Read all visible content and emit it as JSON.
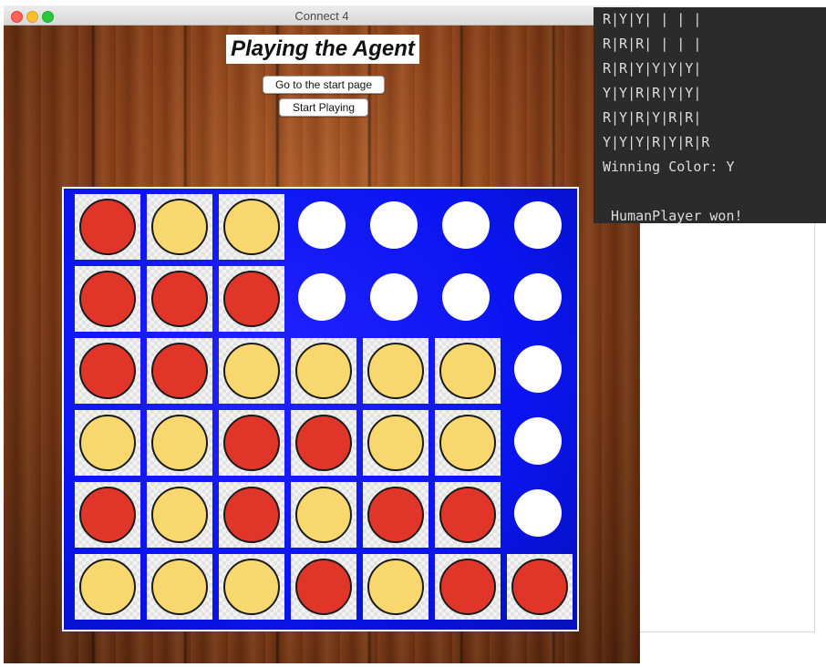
{
  "window": {
    "title": "Connect 4"
  },
  "game": {
    "heading": "Playing the Agent",
    "buttons": {
      "start_page": "Go to the start page",
      "start_playing": "Start Playing"
    },
    "board": [
      [
        "R",
        "Y",
        "Y",
        "E",
        "E",
        "E",
        "E"
      ],
      [
        "R",
        "R",
        "R",
        "E",
        "E",
        "E",
        "E"
      ],
      [
        "R",
        "R",
        "Y",
        "Y",
        "Y",
        "Y",
        "E"
      ],
      [
        "Y",
        "Y",
        "R",
        "R",
        "Y",
        "Y",
        "E"
      ],
      [
        "R",
        "Y",
        "R",
        "Y",
        "R",
        "R",
        "E"
      ],
      [
        "Y",
        "Y",
        "Y",
        "R",
        "Y",
        "R",
        "R"
      ]
    ]
  },
  "colors": {
    "red_disc": "#e2352a",
    "yellow_disc": "#f8d86e",
    "board_blue": "#0a14f0"
  },
  "terminal": {
    "lines": [
      "R|Y|Y| | | |",
      "R|R|R| | | |",
      "R|R|Y|Y|Y|Y|",
      "Y|Y|R|R|Y|Y|",
      "R|Y|R|Y|R|R|",
      "Y|Y|Y|R|Y|R|R",
      "Winning Color: Y",
      "",
      " HumanPlayer won!"
    ]
  }
}
